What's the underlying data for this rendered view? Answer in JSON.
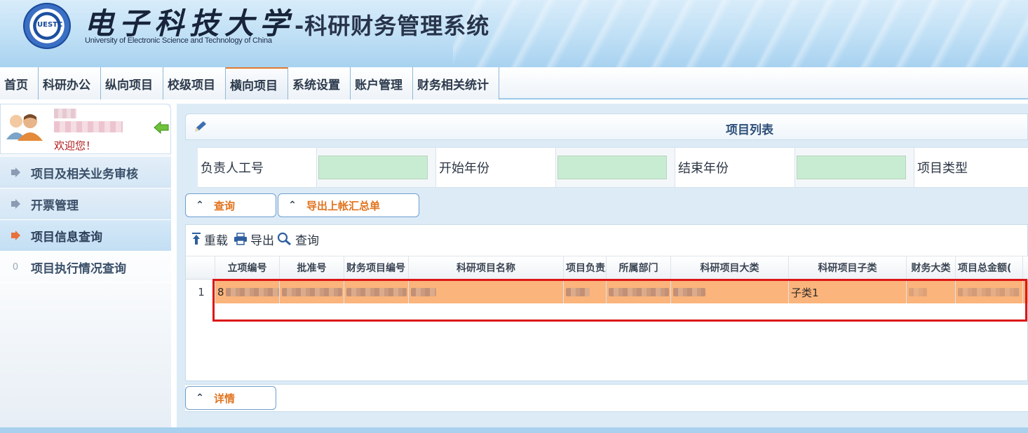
{
  "banner": {
    "logo_cn": "电子科技大学",
    "logo_en": "University of Electronic Science and Technology of China",
    "seal_text": "UESTC",
    "system_title": "-科研财务管理系统"
  },
  "topnav": {
    "tabs": [
      "首页",
      "科研办公",
      "纵向项目",
      "校级项目",
      "横向项目",
      "系统设置",
      "账户管理",
      "财务相关统计"
    ],
    "active": "横向项目"
  },
  "sidebar": {
    "welcome": "欢迎您！",
    "items": [
      "项目及相关业务审核",
      "开票管理",
      "项目信息查询",
      "项目执行情况查询"
    ],
    "active": "项目信息查询",
    "last_item_marker": "0"
  },
  "panel": {
    "title": "项目列表"
  },
  "filter": {
    "labels": [
      "负责人工号",
      "开始年份",
      "结束年份",
      "项目类型"
    ],
    "values": [
      "",
      "",
      ""
    ]
  },
  "buttons": {
    "query": "查询",
    "export_summary": "导出上帐汇总单",
    "detail": "详情"
  },
  "toolbar": {
    "reload": "重载",
    "export": "导出",
    "query": "查询"
  },
  "grid": {
    "columns": [
      "立项编号",
      "批准号",
      "财务项目编号",
      "科研项目名称",
      "项目负责人",
      "所属部门",
      "科研项目大类",
      "科研项目子类",
      "财务大类",
      "项目总金额("
    ],
    "rows": [
      {
        "rownum": "1",
        "first_cell_prefix": "8",
        "subcategory": "子类1"
      }
    ]
  },
  "colors": {
    "selected_row": "#fbb47b",
    "highlight_border": "#dc1717",
    "input_fill": "#c8ecd1",
    "accent_orange": "#e0741f"
  }
}
